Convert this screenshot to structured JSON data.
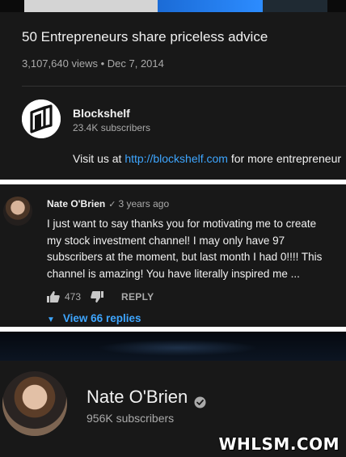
{
  "video": {
    "title": "50 Entrepreneurs share priceless advice",
    "views": "3,107,640 views",
    "separator": "•",
    "date": "Dec 7, 2014"
  },
  "channel": {
    "name": "Blockshelf",
    "subscribers": "23.4K subscribers",
    "description_prefix": "Visit us at ",
    "description_link": "http://blockshelf.com",
    "description_suffix": " for more entrepreneur"
  },
  "comment": {
    "author": "Nate O'Brien",
    "check_glyph": "✓",
    "time": "3 years ago",
    "text": "I just want to say thanks you for motivating me to create my stock investment channel! I may only have 97 subscribers at the moment, but last month I had 0!!!! This channel is amazing! You have literally inspired me ...",
    "likes": "473",
    "reply_label": "REPLY",
    "view_replies": "View 66 replies",
    "chevron_glyph": "▼",
    "icons": {
      "like": "thumb-up-icon",
      "dislike": "thumb-down-icon"
    }
  },
  "profile": {
    "name": "Nate O'Brien",
    "subscribers": "956K subscribers",
    "verified_icon": "verified-check-icon"
  },
  "watermark": "WHLSM.COM",
  "colors": {
    "background": "#181818",
    "link": "#3ea6ff",
    "secondary_text": "#aaaaaa"
  }
}
